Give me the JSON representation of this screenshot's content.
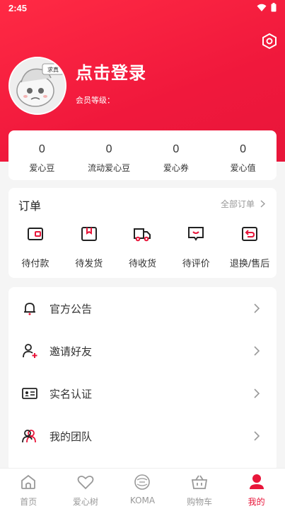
{
  "status_bar": {
    "time": "2:45"
  },
  "profile": {
    "login_prompt": "点击登录",
    "member_level_label": "会员等级：",
    "avatar_badge": "求真"
  },
  "stats": [
    {
      "value": "0",
      "label": "爱心豆"
    },
    {
      "value": "0",
      "label": "流动爱心豆"
    },
    {
      "value": "0",
      "label": "爱心券"
    },
    {
      "value": "0",
      "label": "爱心值"
    }
  ],
  "orders": {
    "title": "订单",
    "all_label": "全部订单",
    "items": [
      {
        "label": "待付款",
        "icon": "wallet-icon"
      },
      {
        "label": "待发货",
        "icon": "box-icon"
      },
      {
        "label": "待收货",
        "icon": "truck-icon"
      },
      {
        "label": "待评价",
        "icon": "comment-icon"
      },
      {
        "label": "退换/售后",
        "icon": "return-icon"
      }
    ]
  },
  "menu": [
    {
      "label": "官方公告",
      "icon": "bell-icon"
    },
    {
      "label": "邀请好友",
      "icon": "add-user-icon"
    },
    {
      "label": "实名认证",
      "icon": "id-card-icon"
    },
    {
      "label": "我的团队",
      "icon": "team-icon"
    }
  ],
  "tabs": [
    {
      "label": "首页",
      "icon": "home-icon"
    },
    {
      "label": "爱心树",
      "icon": "heart-icon"
    },
    {
      "label": "KOMA",
      "icon": "koma-logo-icon"
    },
    {
      "label": "购物车",
      "icon": "cart-icon"
    },
    {
      "label": "我的",
      "icon": "profile-icon",
      "active": true
    }
  ],
  "colors": {
    "accent": "#e8163a",
    "header": "#f0183c"
  }
}
